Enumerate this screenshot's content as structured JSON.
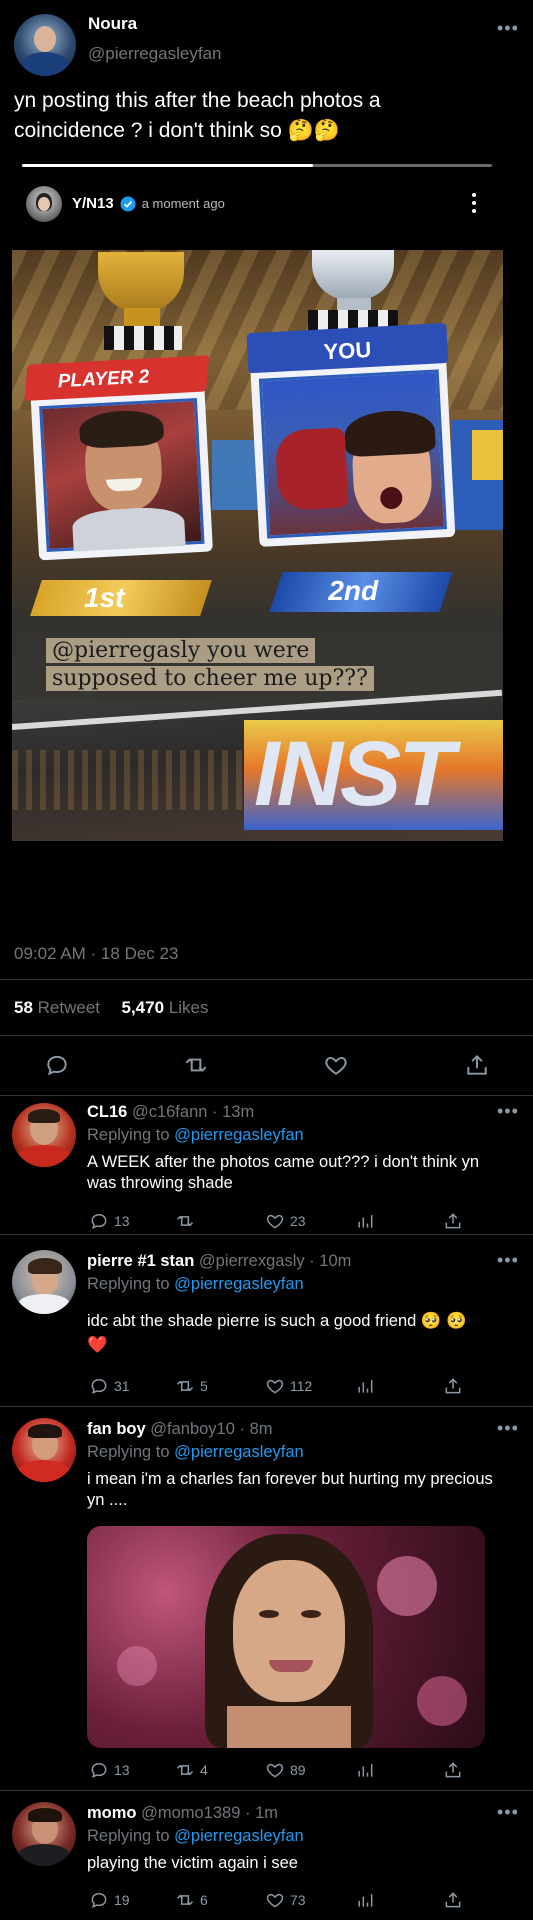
{
  "main_tweet": {
    "name": "Noura",
    "handle": "@pierregasleyfan",
    "text": "yn posting this after the beach photos  a coincidence ? i don't think so 🤔🤔",
    "timestamp": "09:02 AM · 18 Dec 23",
    "retweets_count": "58",
    "retweets_label": "Retweet",
    "likes_count": "5,470",
    "likes_label": "Likes"
  },
  "story": {
    "username": "Y/N13",
    "time": "a moment ago",
    "image_text": {
      "player2_label": "PLAYER 2",
      "you_label": "YOU",
      "first_label": "1st",
      "second_label": "2nd",
      "caption_line1": "@pierregasly you were",
      "caption_line2": "supposed to cheer me up???",
      "banner": "INST"
    }
  },
  "replies": [
    {
      "name": "CL16",
      "handle": "@c16fann",
      "time": "13m",
      "replying_prefix": "Replying to",
      "replying_to": "@pierregasleyfan",
      "text": "A WEEK after the photos came out??? i don't think yn was throwing shade",
      "comments": "13",
      "retweets": "",
      "likes": "23"
    },
    {
      "name": "pierre #1 stan",
      "handle": "@pierrexgasly",
      "time": "10m",
      "replying_prefix": "Replying to",
      "replying_to": "@pierregasleyfan",
      "text": "idc abt the shade pierre is such a good friend 🥺 🥺",
      "text2": "❤️",
      "comments": "31",
      "retweets": "5",
      "likes": "112"
    },
    {
      "name": "fan boy",
      "handle": "@fanboy10",
      "time": "8m",
      "replying_prefix": "Replying to",
      "replying_to": "@pierregasleyfan",
      "text": "i mean i'm a charles fan forever but hurting my precious yn ....",
      "comments": "13",
      "retweets": "4",
      "likes": "89"
    },
    {
      "name": "momo",
      "handle": "@momo1389",
      "time": "1m",
      "replying_prefix": "Replying to",
      "replying_to": "@pierregasleyfan",
      "text": "playing the victim again i see",
      "comments": "19",
      "retweets": "6",
      "likes": "73"
    }
  ],
  "icons": [
    "more-icon",
    "verified-icon",
    "reply-icon",
    "retweet-icon",
    "like-icon",
    "share-icon",
    "analytics-icon"
  ],
  "colors": {
    "background": "#000000",
    "link": "#1d9bf0",
    "muted": "#71767b",
    "verified": "#1d9bf0"
  }
}
